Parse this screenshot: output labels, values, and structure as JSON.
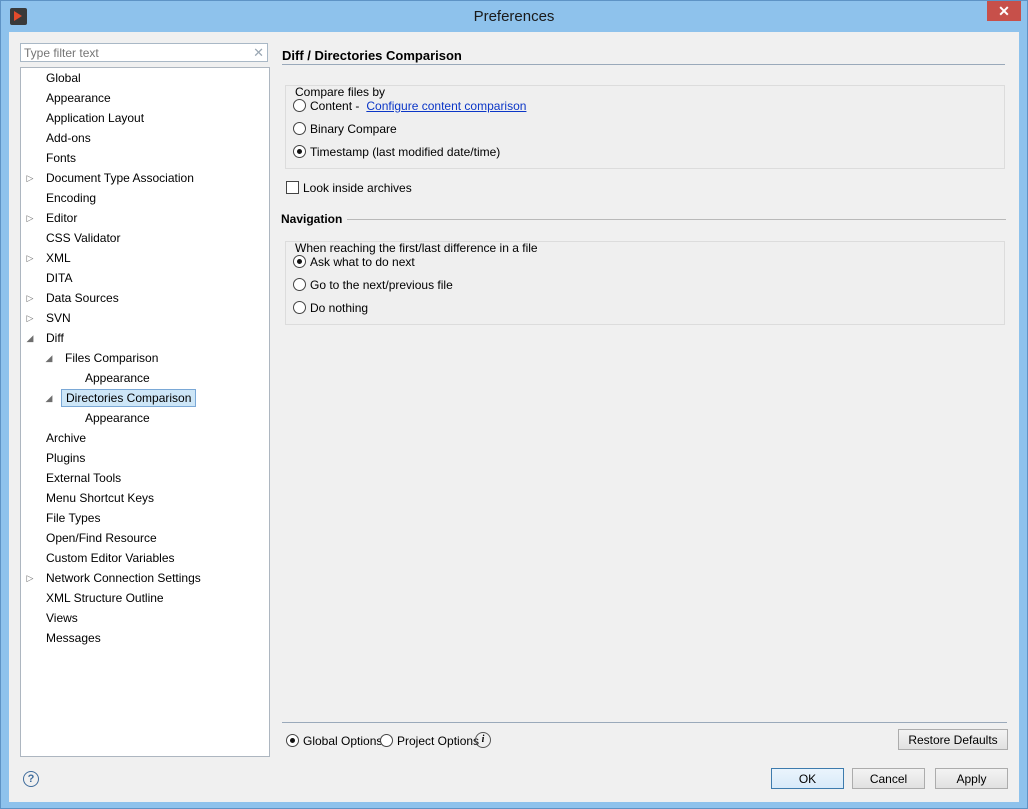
{
  "window": {
    "title": "Preferences",
    "close_glyph": "✕"
  },
  "filter": {
    "placeholder": "Type filter text",
    "clear_glyph": "✕"
  },
  "tree": [
    {
      "label": "Global",
      "level": 0,
      "arrow": ""
    },
    {
      "label": "Appearance",
      "level": 0,
      "arrow": ""
    },
    {
      "label": "Application Layout",
      "level": 0,
      "arrow": ""
    },
    {
      "label": "Add-ons",
      "level": 0,
      "arrow": ""
    },
    {
      "label": "Fonts",
      "level": 0,
      "arrow": ""
    },
    {
      "label": "Document Type Association",
      "level": 0,
      "arrow": "collapsed"
    },
    {
      "label": "Encoding",
      "level": 0,
      "arrow": ""
    },
    {
      "label": "Editor",
      "level": 0,
      "arrow": "collapsed"
    },
    {
      "label": "CSS Validator",
      "level": 0,
      "arrow": ""
    },
    {
      "label": "XML",
      "level": 0,
      "arrow": "collapsed"
    },
    {
      "label": "DITA",
      "level": 0,
      "arrow": ""
    },
    {
      "label": "Data Sources",
      "level": 0,
      "arrow": "collapsed"
    },
    {
      "label": "SVN",
      "level": 0,
      "arrow": "collapsed"
    },
    {
      "label": "Diff",
      "level": 0,
      "arrow": "expanded"
    },
    {
      "label": "Files Comparison",
      "level": 1,
      "arrow": "expanded"
    },
    {
      "label": "Appearance",
      "level": 2,
      "arrow": ""
    },
    {
      "label": "Directories Comparison",
      "level": 1,
      "arrow": "expanded",
      "selected": true
    },
    {
      "label": "Appearance",
      "level": 2,
      "arrow": ""
    },
    {
      "label": "Archive",
      "level": 0,
      "arrow": ""
    },
    {
      "label": "Plugins",
      "level": 0,
      "arrow": ""
    },
    {
      "label": "External Tools",
      "level": 0,
      "arrow": ""
    },
    {
      "label": "Menu Shortcut Keys",
      "level": 0,
      "arrow": ""
    },
    {
      "label": "File Types",
      "level": 0,
      "arrow": ""
    },
    {
      "label": "Open/Find Resource",
      "level": 0,
      "arrow": ""
    },
    {
      "label": "Custom Editor Variables",
      "level": 0,
      "arrow": ""
    },
    {
      "label": "Network Connection Settings",
      "level": 0,
      "arrow": "collapsed"
    },
    {
      "label": "XML Structure Outline",
      "level": 0,
      "arrow": ""
    },
    {
      "label": "Views",
      "level": 0,
      "arrow": ""
    },
    {
      "label": "Messages",
      "level": 0,
      "arrow": ""
    }
  ],
  "page": {
    "title": "Diff / Directories Comparison"
  },
  "compare": {
    "caption": "Compare files by",
    "content_label": "Content -",
    "content_link": "Configure content comparison",
    "binary_label": "Binary Compare",
    "timestamp_label": "Timestamp (last modified date/time)",
    "selected": "timestamp"
  },
  "archives": {
    "label": "Look inside archives",
    "checked": false
  },
  "navigation": {
    "title": "Navigation",
    "caption": "When reaching the first/last difference in a file",
    "ask_label": "Ask what to do next",
    "goto_label": "Go to the next/previous file",
    "nothing_label": "Do nothing",
    "selected": "ask"
  },
  "scope": {
    "global_label": "Global Options",
    "project_label": "Project Options",
    "selected": "global"
  },
  "buttons": {
    "restore": "Restore Defaults",
    "ok": "OK",
    "cancel": "Cancel",
    "apply": "Apply"
  },
  "icons": {
    "info": "i",
    "help": "?"
  },
  "colors": {
    "link": "#0b36c7",
    "selection": "#cde6f7",
    "titlebar": "#8ec2ec"
  }
}
